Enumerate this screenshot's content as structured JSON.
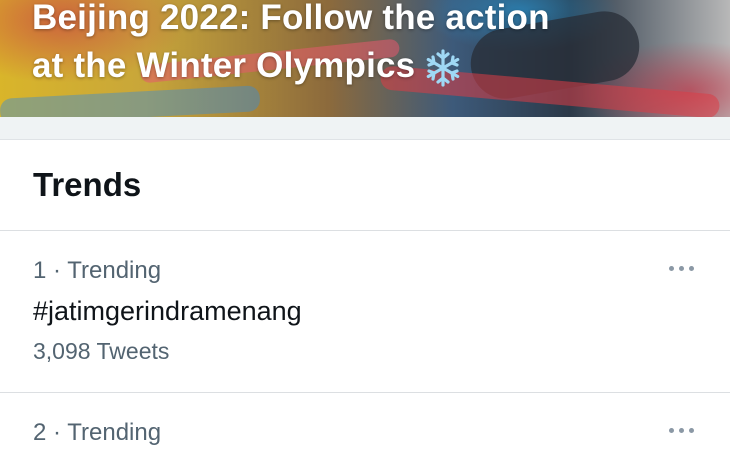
{
  "hero": {
    "title_line1": "Beijing 2022: Follow the action",
    "title_line2": "at the Winter Olympics",
    "emoji_icon": "snowflake-icon"
  },
  "trends": {
    "heading": "Trends",
    "items": [
      {
        "rank_label": "1 · Trending",
        "topic": "#jatimgerindramenang",
        "tweets": "3,098 Tweets"
      },
      {
        "rank_label": "2 · Trending",
        "topic": "",
        "tweets": ""
      }
    ]
  },
  "colors": {
    "text_primary": "#0f1419",
    "text_secondary": "#536471",
    "divider": "#dcdfe2",
    "section_gap": "#eff3f4"
  }
}
